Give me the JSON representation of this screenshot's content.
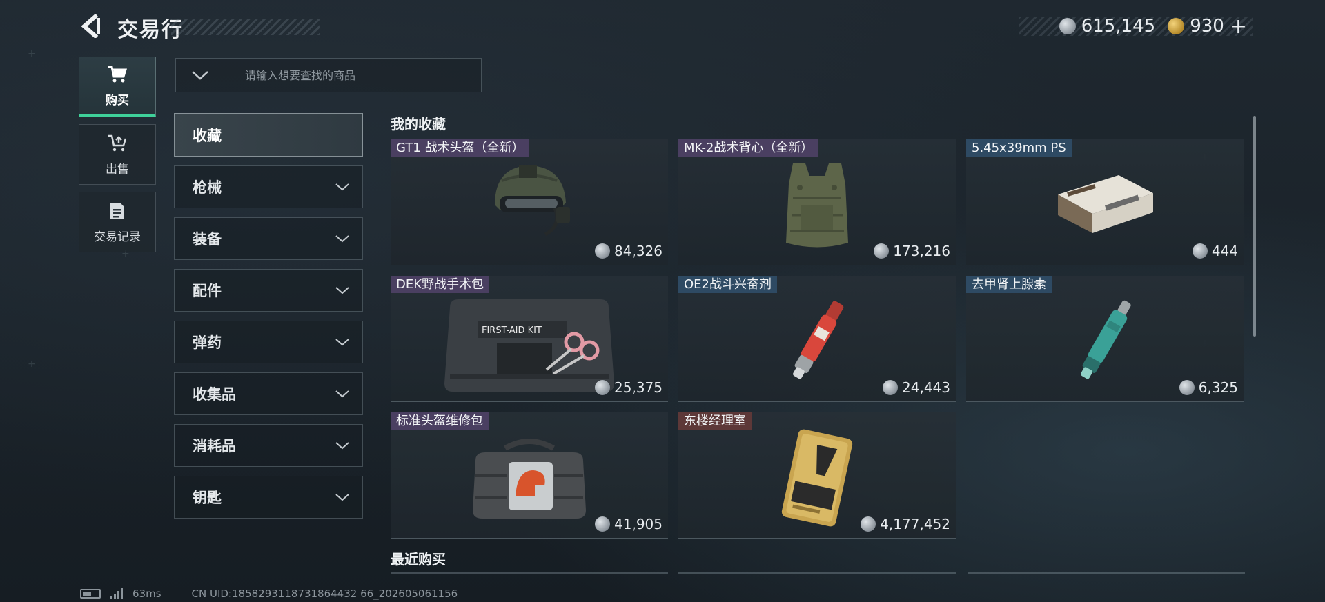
{
  "header": {
    "title": "交易行",
    "silver_amount": "615,145",
    "gold_amount": "930",
    "plus_label": "+"
  },
  "side_nav": [
    {
      "label": "购买",
      "icon": "cart-icon",
      "active": true
    },
    {
      "label": "出售",
      "icon": "sell-cart-icon",
      "active": false
    },
    {
      "label": "交易记录",
      "icon": "document-icon",
      "active": false
    }
  ],
  "search": {
    "placeholder": "请输入想要查找的商品"
  },
  "categories": [
    {
      "label": "收藏",
      "active": true
    },
    {
      "label": "枪械"
    },
    {
      "label": "装备"
    },
    {
      "label": "配件"
    },
    {
      "label": "弹药"
    },
    {
      "label": "收集品"
    },
    {
      "label": "消耗品"
    },
    {
      "label": "钥匙"
    }
  ],
  "favorites": {
    "title": "我的收藏",
    "items": [
      {
        "name": "GT1 战术头盔（全新）",
        "price": "84,326",
        "tag": "purple",
        "icon": "helmet-icon"
      },
      {
        "name": "MK-2战术背心（全新）",
        "price": "173,216",
        "tag": "purple",
        "icon": "vest-icon"
      },
      {
        "name": "5.45x39mm PS",
        "price": "444",
        "tag": "blue",
        "icon": "ammo-box-icon"
      },
      {
        "name": "DEK野战手术包",
        "price": "25,375",
        "tag": "purple",
        "icon": "first-aid-kit-icon",
        "kit_text": "FIRST-AID KIT"
      },
      {
        "name": "OE2战斗兴奋剂",
        "price": "24,443",
        "tag": "blue",
        "icon": "stimulant-injector-red-icon"
      },
      {
        "name": "去甲肾上腺素",
        "price": "6,325",
        "tag": "blue",
        "icon": "stimulant-injector-teal-icon"
      },
      {
        "name": "标准头盔维修包",
        "price": "41,905",
        "tag": "purple",
        "icon": "repair-bag-icon"
      },
      {
        "name": "东楼经理室",
        "price": "4,177,452",
        "tag": "red",
        "icon": "key-card-icon"
      }
    ]
  },
  "recent": {
    "title": "最近购买"
  },
  "status": {
    "ping": "63ms",
    "uid": "CN UID:1858293118731864432 66_202605061156"
  },
  "colors": {
    "accent_green": "#3fd19a",
    "tag_purple": "#4a3f61",
    "tag_blue": "#2e4a63",
    "tag_red": "#5d3838"
  }
}
